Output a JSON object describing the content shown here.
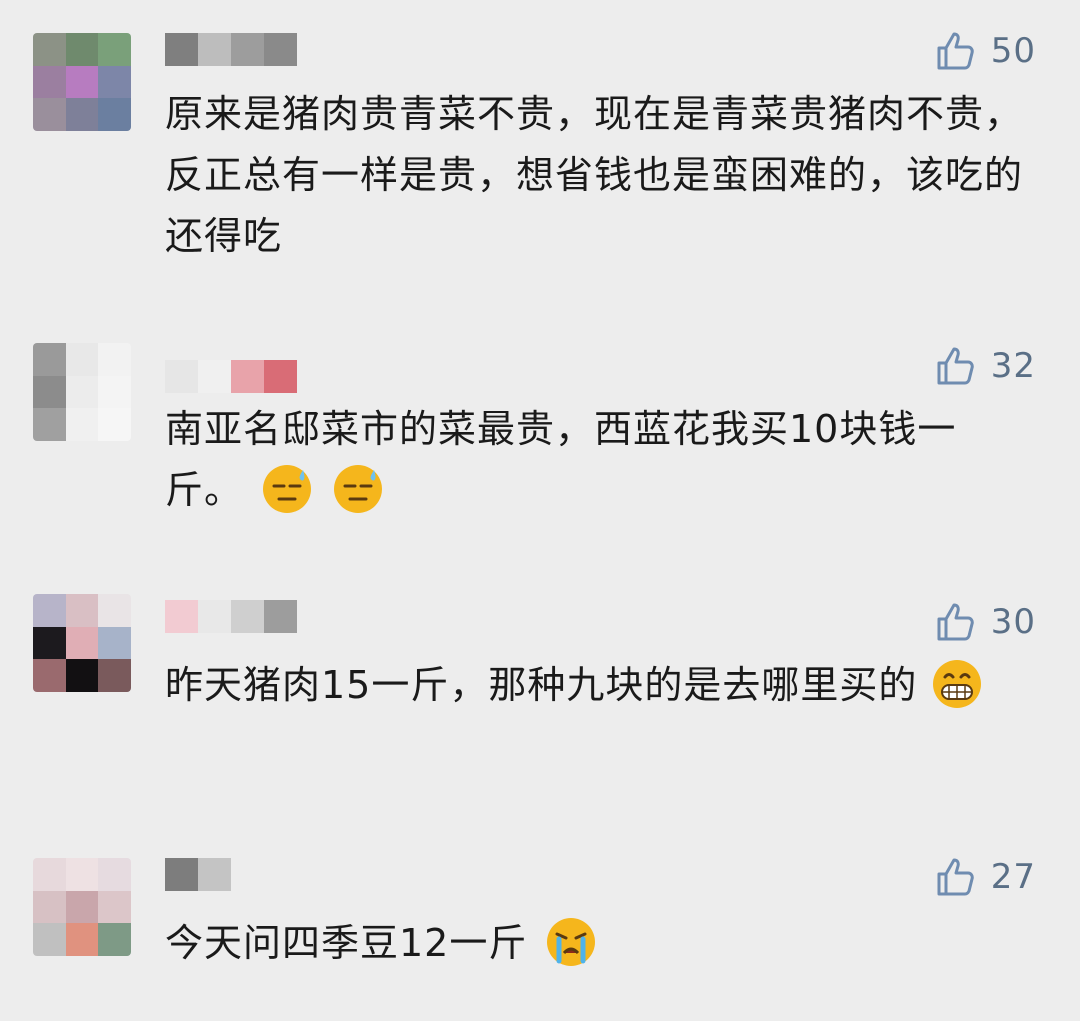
{
  "comments": [
    {
      "likes": "50",
      "text": "原来是猪肉贵青菜不贵，现在是青菜贵猪肉不贵，反正总有一样是贵，想省钱也是蛮困难的，该吃的还得吃",
      "emojis": [],
      "avatar_colors": [
        "#8c9286",
        "#6f8a6d",
        "#7aa07a",
        "#9b7fa0",
        "#b77cc0",
        "#7d86a8",
        "#9a8f9c",
        "#7e8099",
        "#6b7fa0"
      ],
      "name_colors": [
        "#7f7f7f",
        "#bdbdbd",
        "#9d9d9d",
        "#8a8a8a"
      ]
    },
    {
      "likes": "32",
      "text": "南亚名邸菜市的菜最贵，西蓝花我买10块钱一斤。",
      "emojis": [
        "sweat-expressionless-emoji",
        "sweat-expressionless-emoji"
      ],
      "avatar_colors": [
        "#9a9a9a",
        "#e8e8e8",
        "#f2f2f2",
        "#8c8c8c",
        "#ececec",
        "#f4f4f4",
        "#a0a0a0",
        "#f0f0f0",
        "#f6f6f6"
      ],
      "name_colors": [
        "#e6e6e6",
        "#f0f0f0",
        "#e8a3aa",
        "#d96c76"
      ]
    },
    {
      "likes": "30",
      "text": "昨天猪肉15一斤，那种九块的是去哪里买的",
      "emojis": [
        "grinning-teeth-emoji"
      ],
      "avatar_colors": [
        "#b7b4c9",
        "#d9bfc4",
        "#e9e4e6",
        "#1c1a1e",
        "#e0aeb5",
        "#a7b3c9",
        "#9a6a6e",
        "#121012",
        "#7a5a5c"
      ],
      "name_colors": [
        "#f2cbd2",
        "#e8e8e8",
        "#cfcfcf",
        "#9d9d9d"
      ]
    },
    {
      "likes": "27",
      "text": "今天问四季豆12一斤",
      "emojis": [
        "crying-emoji"
      ],
      "avatar_colors": [
        "#e7d9dc",
        "#eee1e3",
        "#e6dbe0",
        "#d7c1c4",
        "#c9a6ab",
        "#dcc6c9",
        "#c0c0c0",
        "#e0927f",
        "#7e9a86"
      ],
      "name_colors": [
        "#7d7d7d",
        "#c4c4c4",
        "#ededed",
        "#ededed"
      ]
    }
  ],
  "icons": {
    "like": "thumbs-up-icon"
  }
}
